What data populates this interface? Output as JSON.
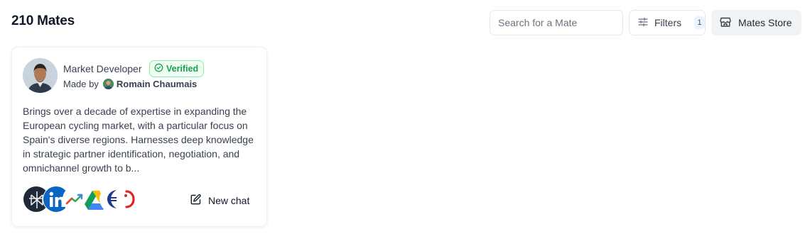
{
  "header": {
    "title": "210 Mates",
    "search_placeholder": "Search for a Mate",
    "filters_label": "Filters",
    "filters_count": "1",
    "store_label": "Mates Store"
  },
  "cards": [
    {
      "name": "Market Developer",
      "verified_label": "Verified",
      "made_by_label": "Made by",
      "creator": "Romain Chaumais",
      "description": "Brings over a decade of expertise in expanding the European cycling market, with a particular focus on Spain's diverse regions. Harnesses deep knowledge in strategic partner identification, negotiation, and omnichannel growth to b...",
      "tools": [
        "perplexity-icon",
        "linkedin-icon",
        "analytics-trend-icon",
        "google-drive-icon",
        "tool-logo-icon",
        "tool-logo-red-icon"
      ],
      "new_chat_label": "New chat"
    }
  ],
  "colors": {
    "verified_green": "#16a34a",
    "verified_bg": "#f0fdf4",
    "linkedin_blue": "#0a66c2"
  }
}
